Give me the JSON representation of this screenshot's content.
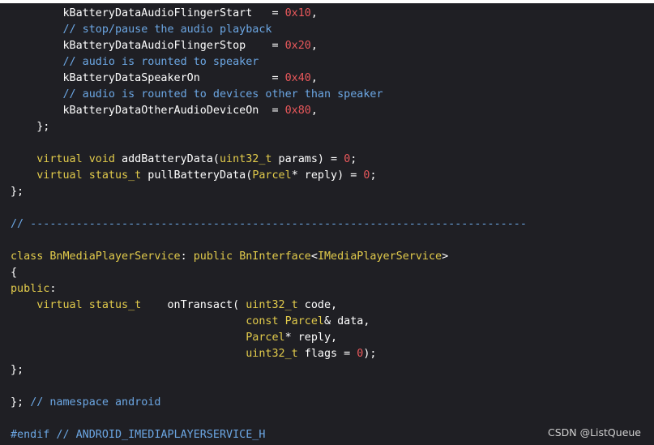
{
  "code_lines": [
    [
      {
        "t": "        kBatteryDataAudioFlingerStart   = ",
        "c": "plain"
      },
      {
        "t": "0x10",
        "c": "number"
      },
      {
        "t": ",",
        "c": "plain"
      }
    ],
    [
      {
        "t": "        // stop/pause the audio playback",
        "c": "comment"
      }
    ],
    [
      {
        "t": "        kBatteryDataAudioFlingerStop    = ",
        "c": "plain"
      },
      {
        "t": "0x20",
        "c": "number"
      },
      {
        "t": ",",
        "c": "plain"
      }
    ],
    [
      {
        "t": "        // audio is rounted to speaker",
        "c": "comment"
      }
    ],
    [
      {
        "t": "        kBatteryDataSpeakerOn           = ",
        "c": "plain"
      },
      {
        "t": "0x40",
        "c": "number"
      },
      {
        "t": ",",
        "c": "plain"
      }
    ],
    [
      {
        "t": "        // audio is rounted to devices other than speaker",
        "c": "comment"
      }
    ],
    [
      {
        "t": "        kBatteryDataOtherAudioDeviceOn  = ",
        "c": "plain"
      },
      {
        "t": "0x80",
        "c": "number"
      },
      {
        "t": ",",
        "c": "plain"
      }
    ],
    [
      {
        "t": "    };",
        "c": "plain"
      }
    ],
    [
      {
        "t": "",
        "c": "plain"
      }
    ],
    [
      {
        "t": "    ",
        "c": "plain"
      },
      {
        "t": "virtual",
        "c": "keyword"
      },
      {
        "t": " ",
        "c": "plain"
      },
      {
        "t": "void",
        "c": "type"
      },
      {
        "t": " addBatteryData(",
        "c": "plain"
      },
      {
        "t": "uint32_t",
        "c": "type"
      },
      {
        "t": " params) = ",
        "c": "plain"
      },
      {
        "t": "0",
        "c": "number"
      },
      {
        "t": ";",
        "c": "plain"
      }
    ],
    [
      {
        "t": "    ",
        "c": "plain"
      },
      {
        "t": "virtual",
        "c": "keyword"
      },
      {
        "t": " ",
        "c": "plain"
      },
      {
        "t": "status_t",
        "c": "type"
      },
      {
        "t": " pullBatteryData(",
        "c": "plain"
      },
      {
        "t": "Parcel",
        "c": "type"
      },
      {
        "t": "* reply) = ",
        "c": "plain"
      },
      {
        "t": "0",
        "c": "number"
      },
      {
        "t": ";",
        "c": "plain"
      }
    ],
    [
      {
        "t": "};",
        "c": "plain"
      }
    ],
    [
      {
        "t": "",
        "c": "plain"
      }
    ],
    [
      {
        "t": "// ----------------------------------------------------------------------------",
        "c": "comment"
      }
    ],
    [
      {
        "t": "",
        "c": "plain"
      }
    ],
    [
      {
        "t": "class",
        "c": "keyword"
      },
      {
        "t": " ",
        "c": "plain"
      },
      {
        "t": "BnMediaPlayerService",
        "c": "type"
      },
      {
        "t": ": ",
        "c": "plain"
      },
      {
        "t": "public",
        "c": "keyword"
      },
      {
        "t": " ",
        "c": "plain"
      },
      {
        "t": "BnInterface",
        "c": "type"
      },
      {
        "t": "<",
        "c": "plain"
      },
      {
        "t": "IMediaPlayerService",
        "c": "type"
      },
      {
        "t": ">",
        "c": "plain"
      }
    ],
    [
      {
        "t": "{",
        "c": "plain"
      }
    ],
    [
      {
        "t": "public",
        "c": "keyword"
      },
      {
        "t": ":",
        "c": "plain"
      }
    ],
    [
      {
        "t": "    ",
        "c": "plain"
      },
      {
        "t": "virtual",
        "c": "keyword"
      },
      {
        "t": " ",
        "c": "plain"
      },
      {
        "t": "status_t",
        "c": "type"
      },
      {
        "t": "    onTransact( ",
        "c": "plain"
      },
      {
        "t": "uint32_t",
        "c": "type"
      },
      {
        "t": " code,",
        "c": "plain"
      }
    ],
    [
      {
        "t": "                                    ",
        "c": "plain"
      },
      {
        "t": "const",
        "c": "keyword"
      },
      {
        "t": " ",
        "c": "plain"
      },
      {
        "t": "Parcel",
        "c": "type"
      },
      {
        "t": "& data,",
        "c": "plain"
      }
    ],
    [
      {
        "t": "                                    ",
        "c": "plain"
      },
      {
        "t": "Parcel",
        "c": "type"
      },
      {
        "t": "* reply,",
        "c": "plain"
      }
    ],
    [
      {
        "t": "                                    ",
        "c": "plain"
      },
      {
        "t": "uint32_t",
        "c": "type"
      },
      {
        "t": " flags = ",
        "c": "plain"
      },
      {
        "t": "0",
        "c": "number"
      },
      {
        "t": ");",
        "c": "plain"
      }
    ],
    [
      {
        "t": "};",
        "c": "plain"
      }
    ],
    [
      {
        "t": "",
        "c": "plain"
      }
    ],
    [
      {
        "t": "}; ",
        "c": "plain"
      },
      {
        "t": "// namespace android",
        "c": "comment"
      }
    ],
    [
      {
        "t": "",
        "c": "plain"
      }
    ],
    [
      {
        "t": "#endif // ANDROID_IMEDIAPLAYERSERVICE_H",
        "c": "preproc"
      }
    ]
  ],
  "watermark": "CSDN @ListQueue",
  "colors": {
    "background": "#1f1f24",
    "plain": "#ffffff",
    "comment": "#6ca7e4",
    "keyword": "#e2cb4b",
    "type": "#e2cb4b",
    "number": "#e9585b",
    "preproc": "#6ca7e4"
  }
}
